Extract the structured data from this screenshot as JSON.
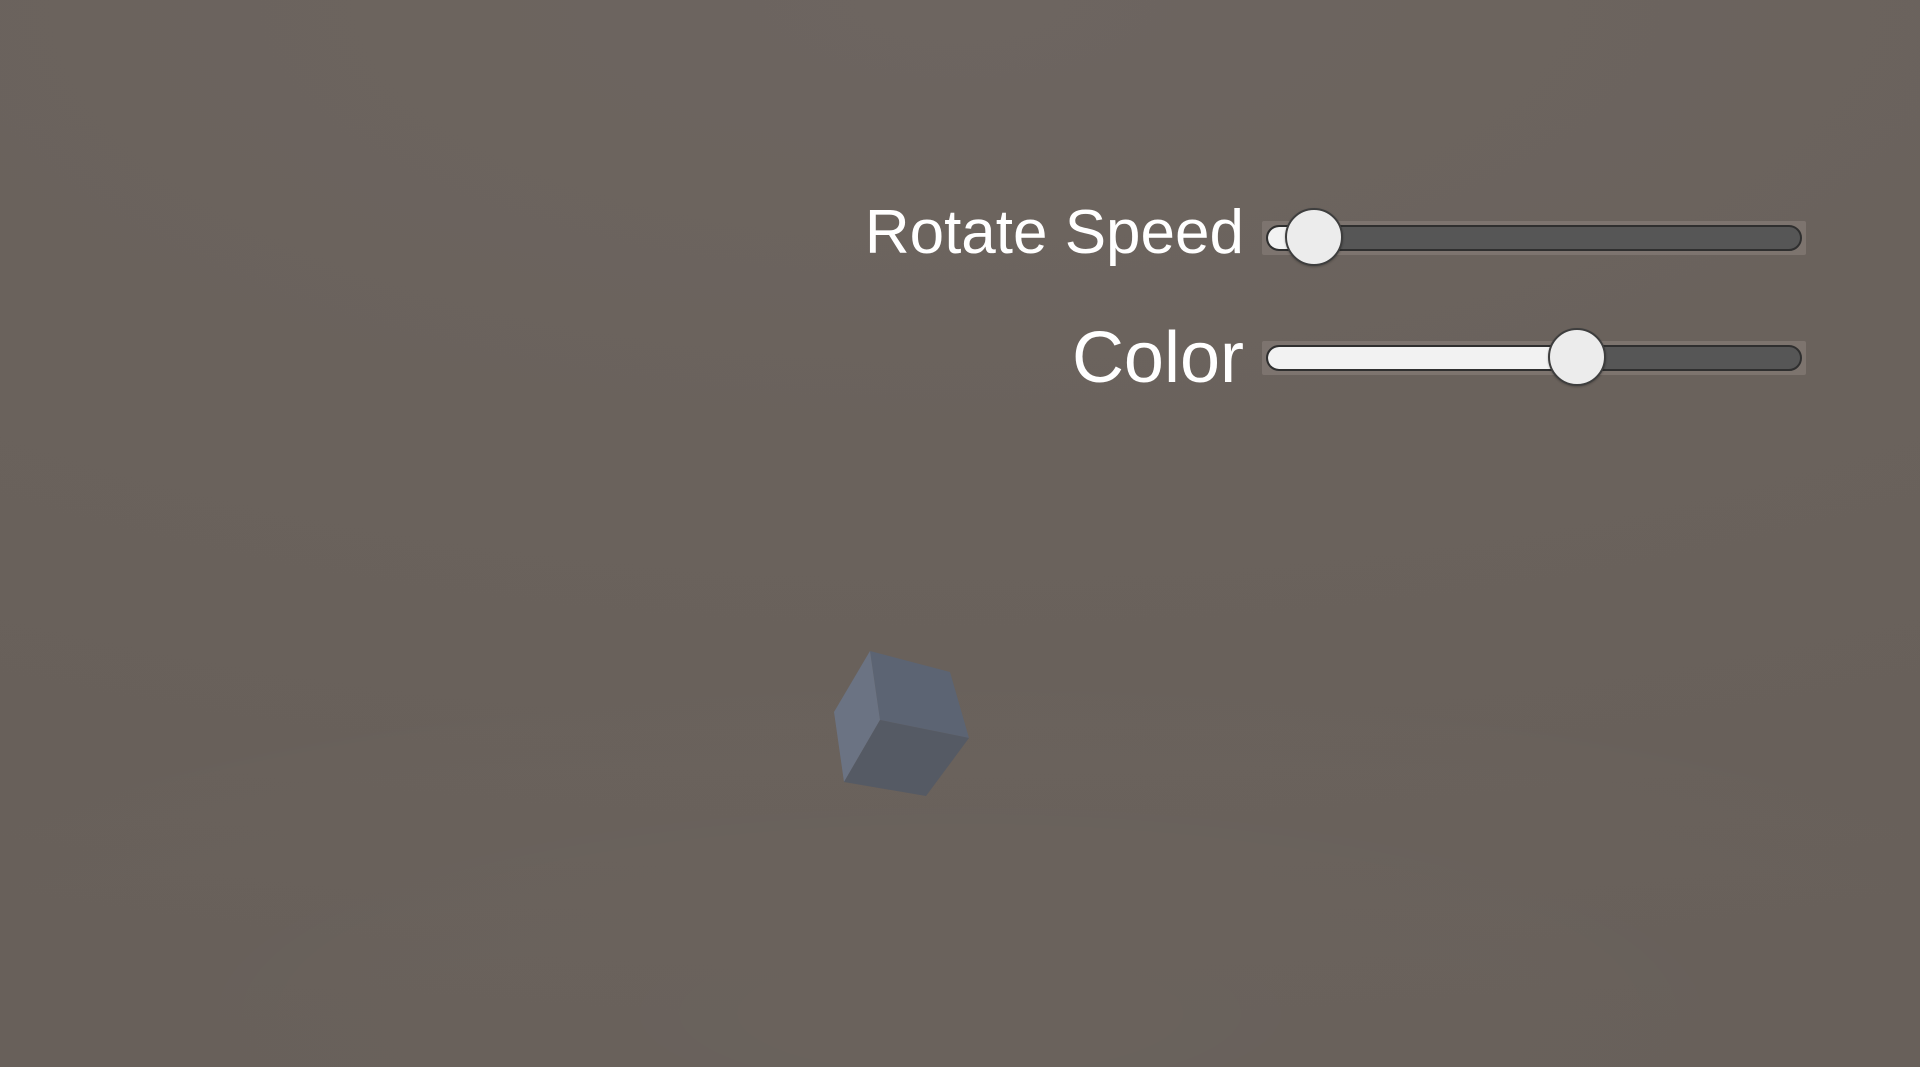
{
  "sliders": [
    {
      "label": "Rotate Speed",
      "value": 0.09
    },
    {
      "label": "Color",
      "value": 0.58
    }
  ],
  "colors": {
    "background": "#6a625c",
    "label_text": "#ffffff",
    "track": "#565656",
    "fill": "#f2f2f2",
    "handle": "#ececec",
    "cube_top": "#5c6473",
    "cube_left": "#6b7383",
    "cube_front": "#555a64"
  },
  "scene": {
    "object": "cube"
  }
}
